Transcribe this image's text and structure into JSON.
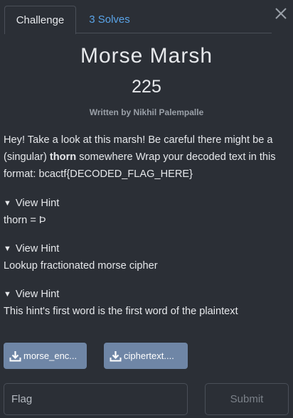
{
  "tabs": [
    {
      "label": "Challenge",
      "active": true
    },
    {
      "label": "3 Solves",
      "active": false
    }
  ],
  "challenge": {
    "title": "Morse Marsh",
    "points": "225",
    "author": "Written by Nikhil Palempalle",
    "description": {
      "part1": "Hey! Take a look at this marsh! Be careful there might be a (singular) ",
      "bold": "thorn",
      "part2": " somewhere Wrap your decoded text in this format: bcactf{DECODED_FLAG_HERE}"
    }
  },
  "hints": [
    {
      "toggle_label": "View Hint",
      "text": "thorn = Þ"
    },
    {
      "toggle_label": "View Hint",
      "text": "Lookup fractionated morse cipher"
    },
    {
      "toggle_label": "View Hint",
      "text": "This hint's first word is the first word of the plaintext"
    }
  ],
  "files": [
    {
      "label": "morse_enc...",
      "icon": "download-icon"
    },
    {
      "label": "ciphertext....",
      "icon": "download-icon"
    }
  ],
  "flag_form": {
    "placeholder": "Flag",
    "value": "",
    "submit_label": "Submit"
  },
  "colors": {
    "background": "#2b2f36",
    "link": "#5aa4e8",
    "file_button": "#6f86a6",
    "border": "#4a4f58"
  }
}
